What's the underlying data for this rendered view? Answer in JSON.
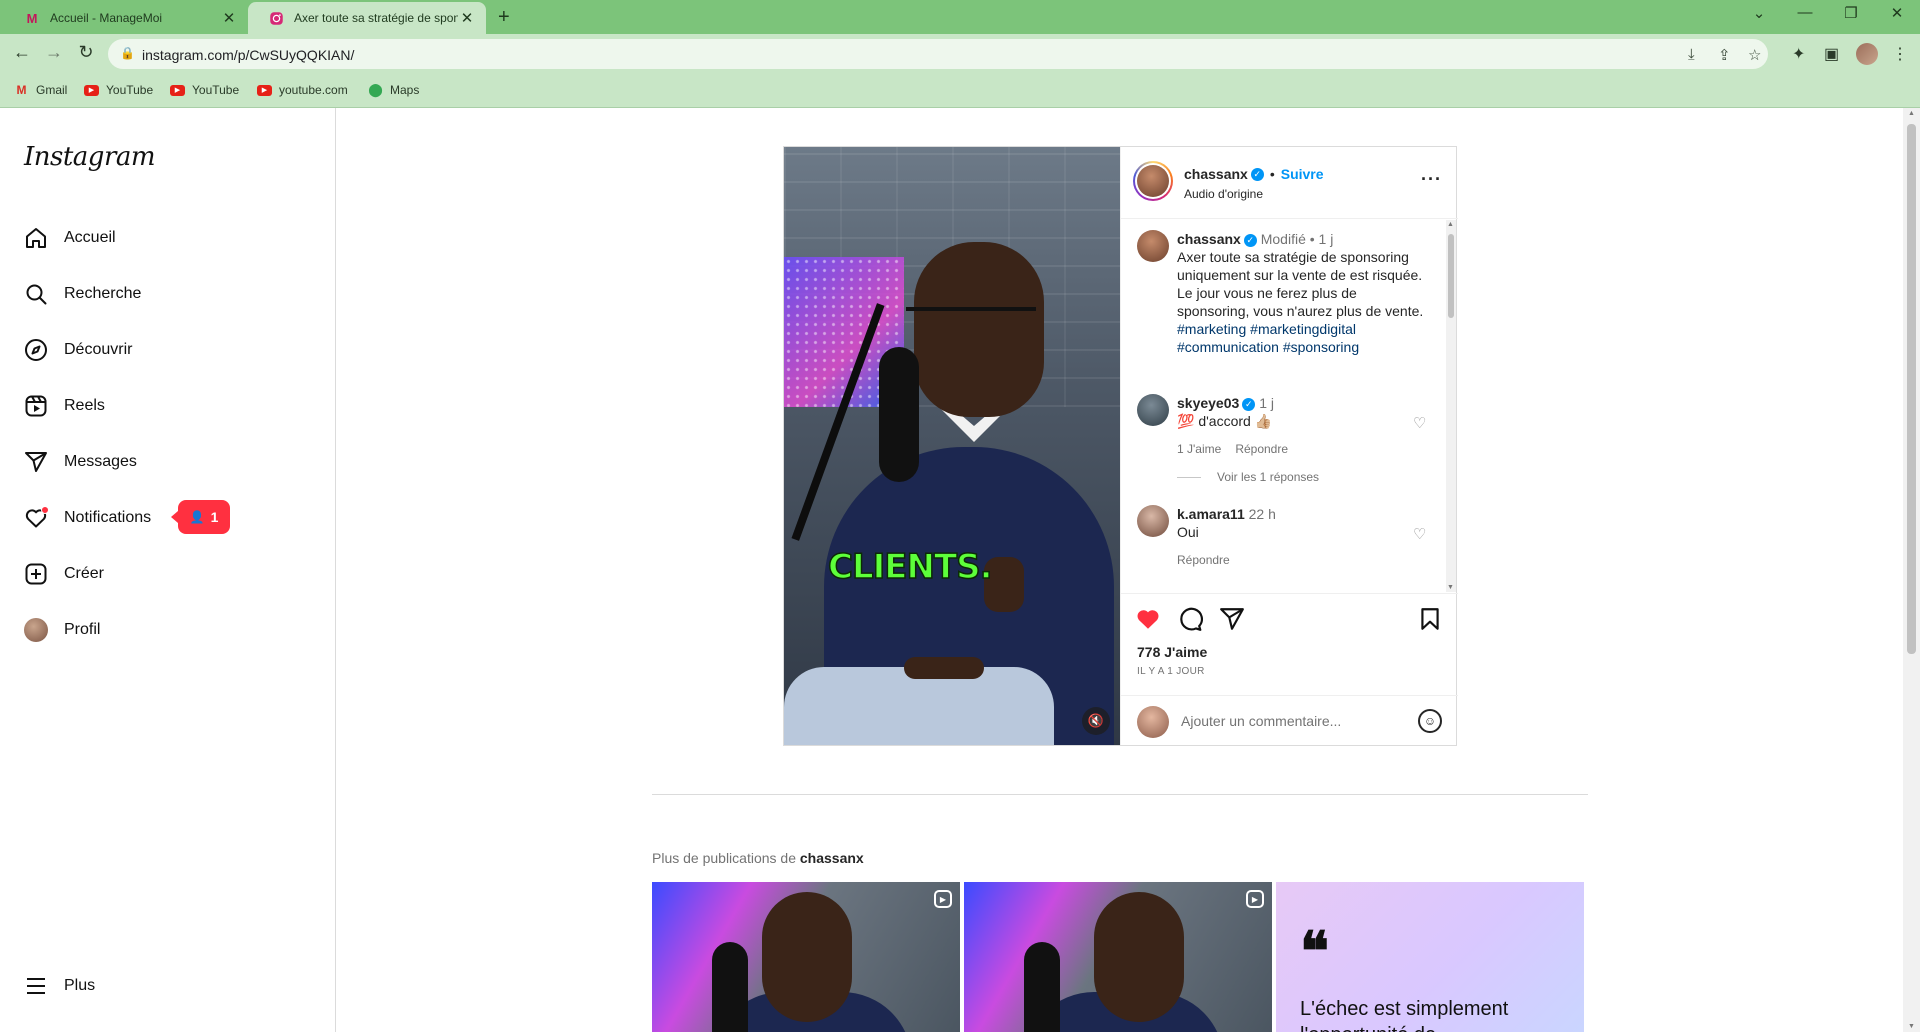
{
  "browser": {
    "tabs": [
      {
        "title": "Accueil - ManageMoi",
        "favicon": "M",
        "active": false
      },
      {
        "title": "Axer toute sa stratégie de sponsor",
        "favicon": "instagram-icon",
        "active": true
      }
    ],
    "url": "instagram.com/p/CwSUyQQKIAN/",
    "bookmarks": [
      {
        "label": "Gmail",
        "icon": "gmail-icon"
      },
      {
        "label": "YouTube",
        "icon": "youtube-icon"
      },
      {
        "label": "YouTube",
        "icon": "youtube-icon"
      },
      {
        "label": "youtube.com",
        "icon": "youtube-icon"
      },
      {
        "label": "Maps",
        "icon": "maps-icon"
      }
    ]
  },
  "instagram": {
    "logo": "Instagram",
    "nav": [
      {
        "label": "Accueil",
        "icon": "home-icon"
      },
      {
        "label": "Recherche",
        "icon": "search-icon"
      },
      {
        "label": "Découvrir",
        "icon": "compass-icon"
      },
      {
        "label": "Reels",
        "icon": "reels-icon"
      },
      {
        "label": "Messages",
        "icon": "send-icon"
      },
      {
        "label": "Notifications",
        "icon": "heart-icon"
      },
      {
        "label": "Créer",
        "icon": "plus-square-icon"
      },
      {
        "label": "Profil",
        "icon": "avatar"
      }
    ],
    "notification_badge": "1",
    "more_label": "Plus",
    "post": {
      "video_caption": "CLIENTS.",
      "author": "chassanx",
      "follow_label": "Suivre",
      "audio": "Audio d'origine",
      "caption": {
        "username": "chassanx",
        "edited": "Modifié",
        "time": "1 j",
        "text": "Axer toute sa stratégie de sponsoring uniquement sur la vente de est risquée. Le jour vous ne ferez plus de sponsoring, vous n'aurez plus de vente.",
        "hashtags": [
          "#marketing",
          "#marketingdigital",
          "#communication",
          "#sponsoring"
        ]
      },
      "comments": [
        {
          "username": "skyeye03",
          "verified": true,
          "time": "1 j",
          "text": "💯 d'accord 👍🏼",
          "likes_label": "1 J'aime",
          "reply_label": "Répondre",
          "view_replies": "Voir les 1 réponses"
        },
        {
          "username": "k.amara11",
          "verified": false,
          "time": "22 h",
          "text": "Oui",
          "reply_label": "Répondre"
        }
      ],
      "liked": true,
      "likes": "778 J'aime",
      "date": "IL Y A 1 JOUR",
      "comment_placeholder": "Ajouter un commentaire..."
    },
    "more_posts": {
      "prefix": "Plus de publications de",
      "username": "chassanx",
      "quote_text": "L'échec est simplement l'opportunité de"
    }
  },
  "colors": {
    "chrome_tabbar": "#7cc47a",
    "chrome_toolbar": "#c8e6c6",
    "instagram_blue": "#0095f6",
    "like_red": "#ff3040"
  }
}
